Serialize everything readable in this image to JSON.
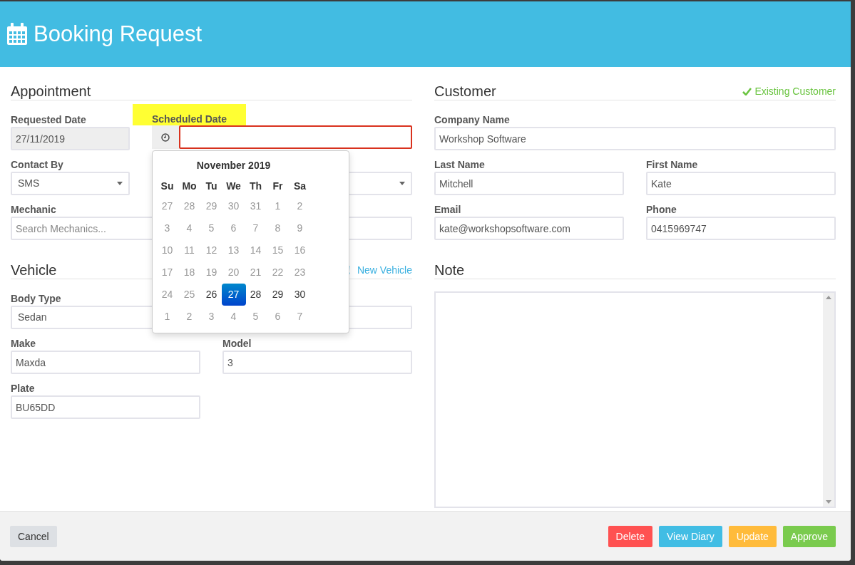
{
  "window": {
    "title": "Booking Request"
  },
  "appointment": {
    "heading": "Appointment",
    "rows": [
      [
        {
          "kind": "text",
          "label": "Requested Date",
          "value": "27/11/2019",
          "disabled": true
        },
        {
          "kind": "date",
          "label": "Scheduled Date",
          "highlighted": true,
          "error": true
        }
      ],
      [
        {
          "kind": "select",
          "label": "Contact By",
          "value": "SMS"
        },
        {
          "kind": "select"
        }
      ],
      [
        {
          "kind": "text",
          "label": "Mechanic",
          "placeholder": "Search Mechanics..."
        },
        {
          "kind": "text"
        }
      ]
    ]
  },
  "datepicker": {
    "month": "November 2019",
    "weekdays": [
      "Su",
      "Mo",
      "Tu",
      "We",
      "Th",
      "Fr",
      "Sa"
    ],
    "weeks": [
      {
        "days": [
          {
            "label": "27",
            "muted": true,
            "selected": false
          },
          {
            "label": "28",
            "muted": true,
            "selected": false
          },
          {
            "label": "29",
            "muted": true,
            "selected": false
          },
          {
            "label": "30",
            "muted": true,
            "selected": false
          },
          {
            "label": "31",
            "muted": true,
            "selected": false
          },
          {
            "label": "1",
            "muted": true,
            "selected": false
          },
          {
            "label": "2",
            "muted": true,
            "selected": false
          }
        ]
      },
      {
        "days": [
          {
            "label": "3",
            "muted": true,
            "selected": false
          },
          {
            "label": "4",
            "muted": true,
            "selected": false
          },
          {
            "label": "5",
            "muted": true,
            "selected": false
          },
          {
            "label": "6",
            "muted": true,
            "selected": false
          },
          {
            "label": "7",
            "muted": true,
            "selected": false
          },
          {
            "label": "8",
            "muted": true,
            "selected": false
          },
          {
            "label": "9",
            "muted": true,
            "selected": false
          }
        ]
      },
      {
        "days": [
          {
            "label": "10",
            "muted": true,
            "selected": false
          },
          {
            "label": "11",
            "muted": true,
            "selected": false
          },
          {
            "label": "12",
            "muted": true,
            "selected": false
          },
          {
            "label": "13",
            "muted": true,
            "selected": false
          },
          {
            "label": "14",
            "muted": true,
            "selected": false
          },
          {
            "label": "15",
            "muted": true,
            "selected": false
          },
          {
            "label": "16",
            "muted": true,
            "selected": false
          }
        ]
      },
      {
        "days": [
          {
            "label": "17",
            "muted": true,
            "selected": false
          },
          {
            "label": "18",
            "muted": true,
            "selected": false
          },
          {
            "label": "19",
            "muted": true,
            "selected": false
          },
          {
            "label": "20",
            "muted": true,
            "selected": false
          },
          {
            "label": "21",
            "muted": true,
            "selected": false
          },
          {
            "label": "22",
            "muted": true,
            "selected": false
          },
          {
            "label": "23",
            "muted": true,
            "selected": false
          }
        ]
      },
      {
        "days": [
          {
            "label": "24",
            "muted": true,
            "selected": false
          },
          {
            "label": "25",
            "muted": true,
            "selected": false
          },
          {
            "label": "26",
            "muted": false,
            "selected": false
          },
          {
            "label": "27",
            "muted": false,
            "selected": true
          },
          {
            "label": "28",
            "muted": false,
            "selected": false
          },
          {
            "label": "29",
            "muted": false,
            "selected": false
          },
          {
            "label": "30",
            "muted": false,
            "selected": false
          }
        ]
      },
      {
        "days": [
          {
            "label": "1",
            "muted": true,
            "selected": false
          },
          {
            "label": "2",
            "muted": true,
            "selected": false
          },
          {
            "label": "3",
            "muted": true,
            "selected": false
          },
          {
            "label": "4",
            "muted": true,
            "selected": false
          },
          {
            "label": "5",
            "muted": true,
            "selected": false
          },
          {
            "label": "6",
            "muted": true,
            "selected": false
          },
          {
            "label": "7",
            "muted": true,
            "selected": false
          }
        ]
      }
    ]
  },
  "vehicle": {
    "heading": "Vehicle",
    "link": "New Vehicle",
    "rows": [
      [
        {
          "kind": "select",
          "label": "Body Type",
          "value": "Sedan"
        },
        {
          "kind": "text"
        }
      ],
      [
        {
          "kind": "text",
          "label": "Make",
          "value": "Maxda"
        },
        {
          "kind": "text",
          "label": "Model",
          "value": "3"
        }
      ],
      [
        {
          "kind": "text",
          "label": "Plate",
          "value": "BU65DD"
        }
      ]
    ]
  },
  "customer": {
    "heading": "Customer",
    "badge": "Existing Customer",
    "rows": [
      [
        {
          "kind": "text",
          "label": "Company Name",
          "value": "Workshop Software"
        }
      ],
      [
        {
          "kind": "text",
          "label": "Last Name",
          "value": "Mitchell"
        },
        {
          "kind": "text",
          "label": "First Name",
          "value": "Kate"
        }
      ],
      [
        {
          "kind": "text",
          "label": "Email",
          "value": "kate@workshopsoftware.com"
        },
        {
          "kind": "text",
          "label": "Phone",
          "value": "0415969747"
        }
      ]
    ]
  },
  "note": {
    "heading": "Note"
  },
  "footer": {
    "cancel": "Cancel",
    "buttons": [
      {
        "label": "Delete",
        "kind": "danger"
      },
      {
        "label": "View Diary",
        "kind": "info"
      },
      {
        "label": "Update",
        "kind": "warning"
      },
      {
        "label": "Approve",
        "kind": "success"
      }
    ]
  }
}
